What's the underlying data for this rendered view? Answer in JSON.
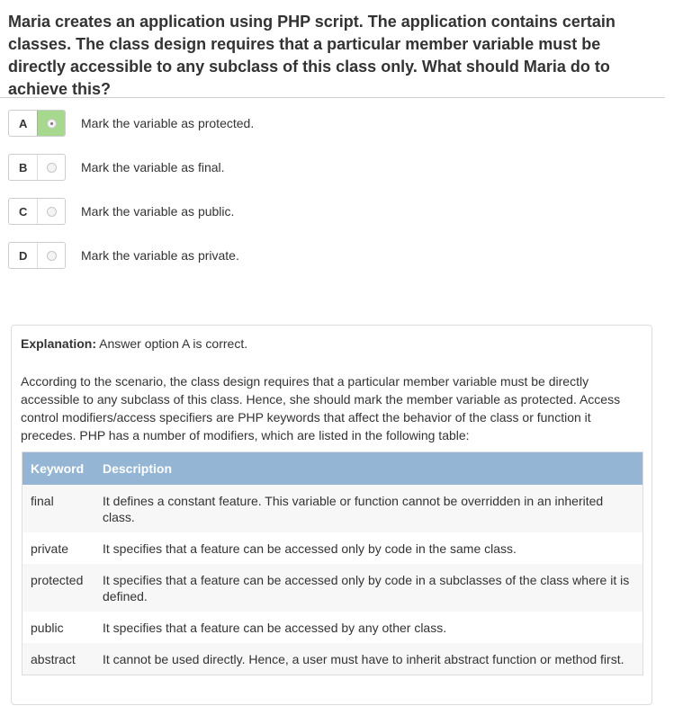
{
  "question": "Maria creates an application using PHP script. The application contains certain classes. The class design requires that a particular member variable must be directly accessible to any subclass of this class only. What should Maria do to achieve this?",
  "options": [
    {
      "letter": "A",
      "text": "Mark the variable as protected.",
      "selected": true
    },
    {
      "letter": "B",
      "text": "Mark the variable as final.",
      "selected": false
    },
    {
      "letter": "C",
      "text": "Mark the variable as public.",
      "selected": false
    },
    {
      "letter": "D",
      "text": "Mark the variable as private.",
      "selected": false
    }
  ],
  "explanation": {
    "label": "Explanation:",
    "summary": "Answer option A is correct.",
    "paragraph": "According to the scenario, the class design requires that a particular member variable must be directly accessible to any subclass of this class. Hence, she should mark the member variable as protected. Access control modifiers/access specifiers are PHP keywords that affect the behavior of the class or function it precedes. PHP has a number of modifiers, which are listed in the following table:",
    "table": {
      "headers": [
        "Keyword",
        "Description"
      ],
      "rows": [
        {
          "keyword": "final",
          "description": "It defines a constant feature. This variable or function cannot be overridden in an inherited class."
        },
        {
          "keyword": "private",
          "description": "It specifies that a feature can be accessed only by code in the same class."
        },
        {
          "keyword": "protected",
          "description": "It specifies that a feature can be accessed only by code in a subclasses of the class where it is defined."
        },
        {
          "keyword": "public",
          "description": "It specifies that a feature can be accessed by any other class."
        },
        {
          "keyword": "abstract",
          "description": "It cannot be used directly. Hence, a user must have to inherit abstract function or method first."
        }
      ]
    }
  },
  "colors": {
    "selected_green": "#a6d98e",
    "table_header_blue": "#94b6d4"
  }
}
